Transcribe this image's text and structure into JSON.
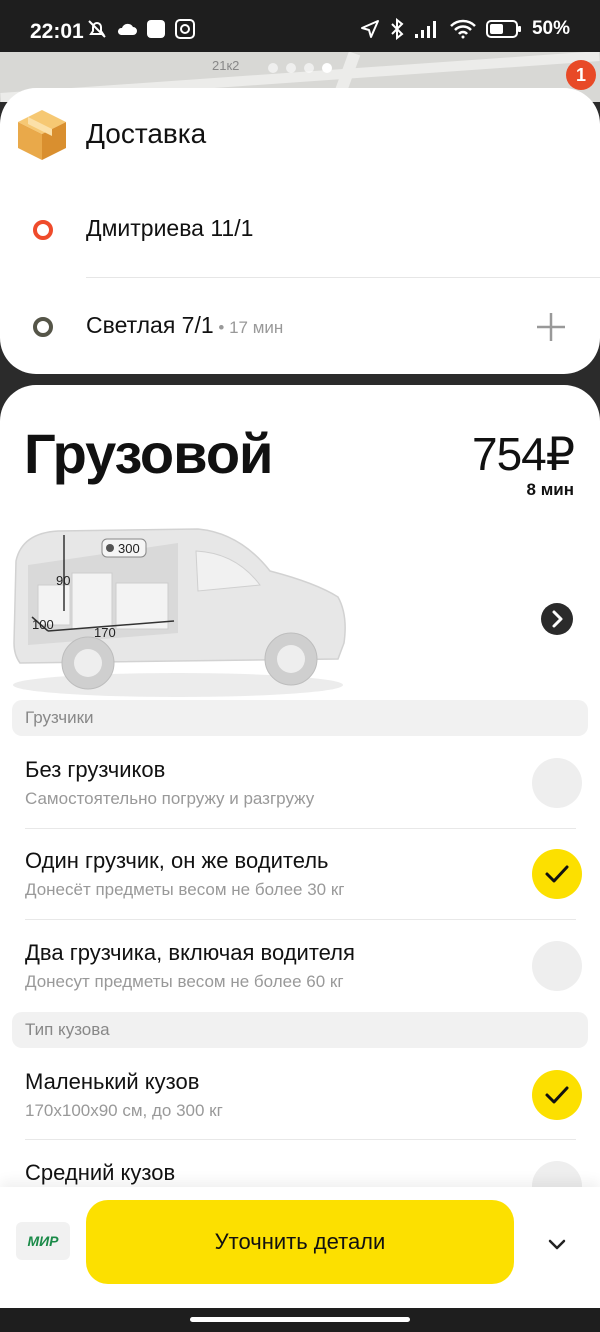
{
  "status_bar": {
    "time": "22:01",
    "battery": "50%",
    "left_icons": [
      "muted-bell-icon",
      "cloud-icon",
      "app-square-icon",
      "alarm-icon"
    ],
    "right_icons": [
      "location-icon",
      "bluetooth-icon",
      "signal-icon",
      "wifi-icon",
      "battery-icon"
    ]
  },
  "map": {
    "label": "21к2",
    "badge_count": "1",
    "page_dots": 4,
    "active_dot": 3
  },
  "route": {
    "service_title": "Доставка",
    "point_a": "Дмитриева 11/1",
    "point_b": "Светлая 7/1",
    "point_b_eta": " • 17 мин"
  },
  "tariff": {
    "name": "Грузовой",
    "price": "754₽",
    "eta": "8 мин",
    "van": {
      "height": "90",
      "width": "100",
      "length": "170",
      "weight": "300"
    }
  },
  "sections": {
    "loaders": {
      "title": "Грузчики",
      "options": [
        {
          "title": "Без грузчиков",
          "subtitle": "Самостоятельно погружу и разгружу",
          "selected": false
        },
        {
          "title": "Один грузчик, он же водитель",
          "subtitle": "Донесёт предметы весом не более 30 кг",
          "selected": true
        },
        {
          "title": "Два грузчика, включая водителя",
          "subtitle": "Донесут предметы весом не более 60 кг",
          "selected": false
        }
      ]
    },
    "body": {
      "title": "Тип кузова",
      "options": [
        {
          "title": "Маленький кузов",
          "subtitle": "170x100x90 см, до 300 кг",
          "selected": true
        },
        {
          "title": "Средний кузов",
          "subtitle": "",
          "selected": false
        }
      ]
    }
  },
  "bottom": {
    "payment_label": "МИР",
    "cta_label": "Уточнить детали"
  },
  "colors": {
    "accent_yellow": "#fce000",
    "point_a": "#ef4b2b",
    "point_b": "#555548",
    "badge": "#e84a27"
  }
}
